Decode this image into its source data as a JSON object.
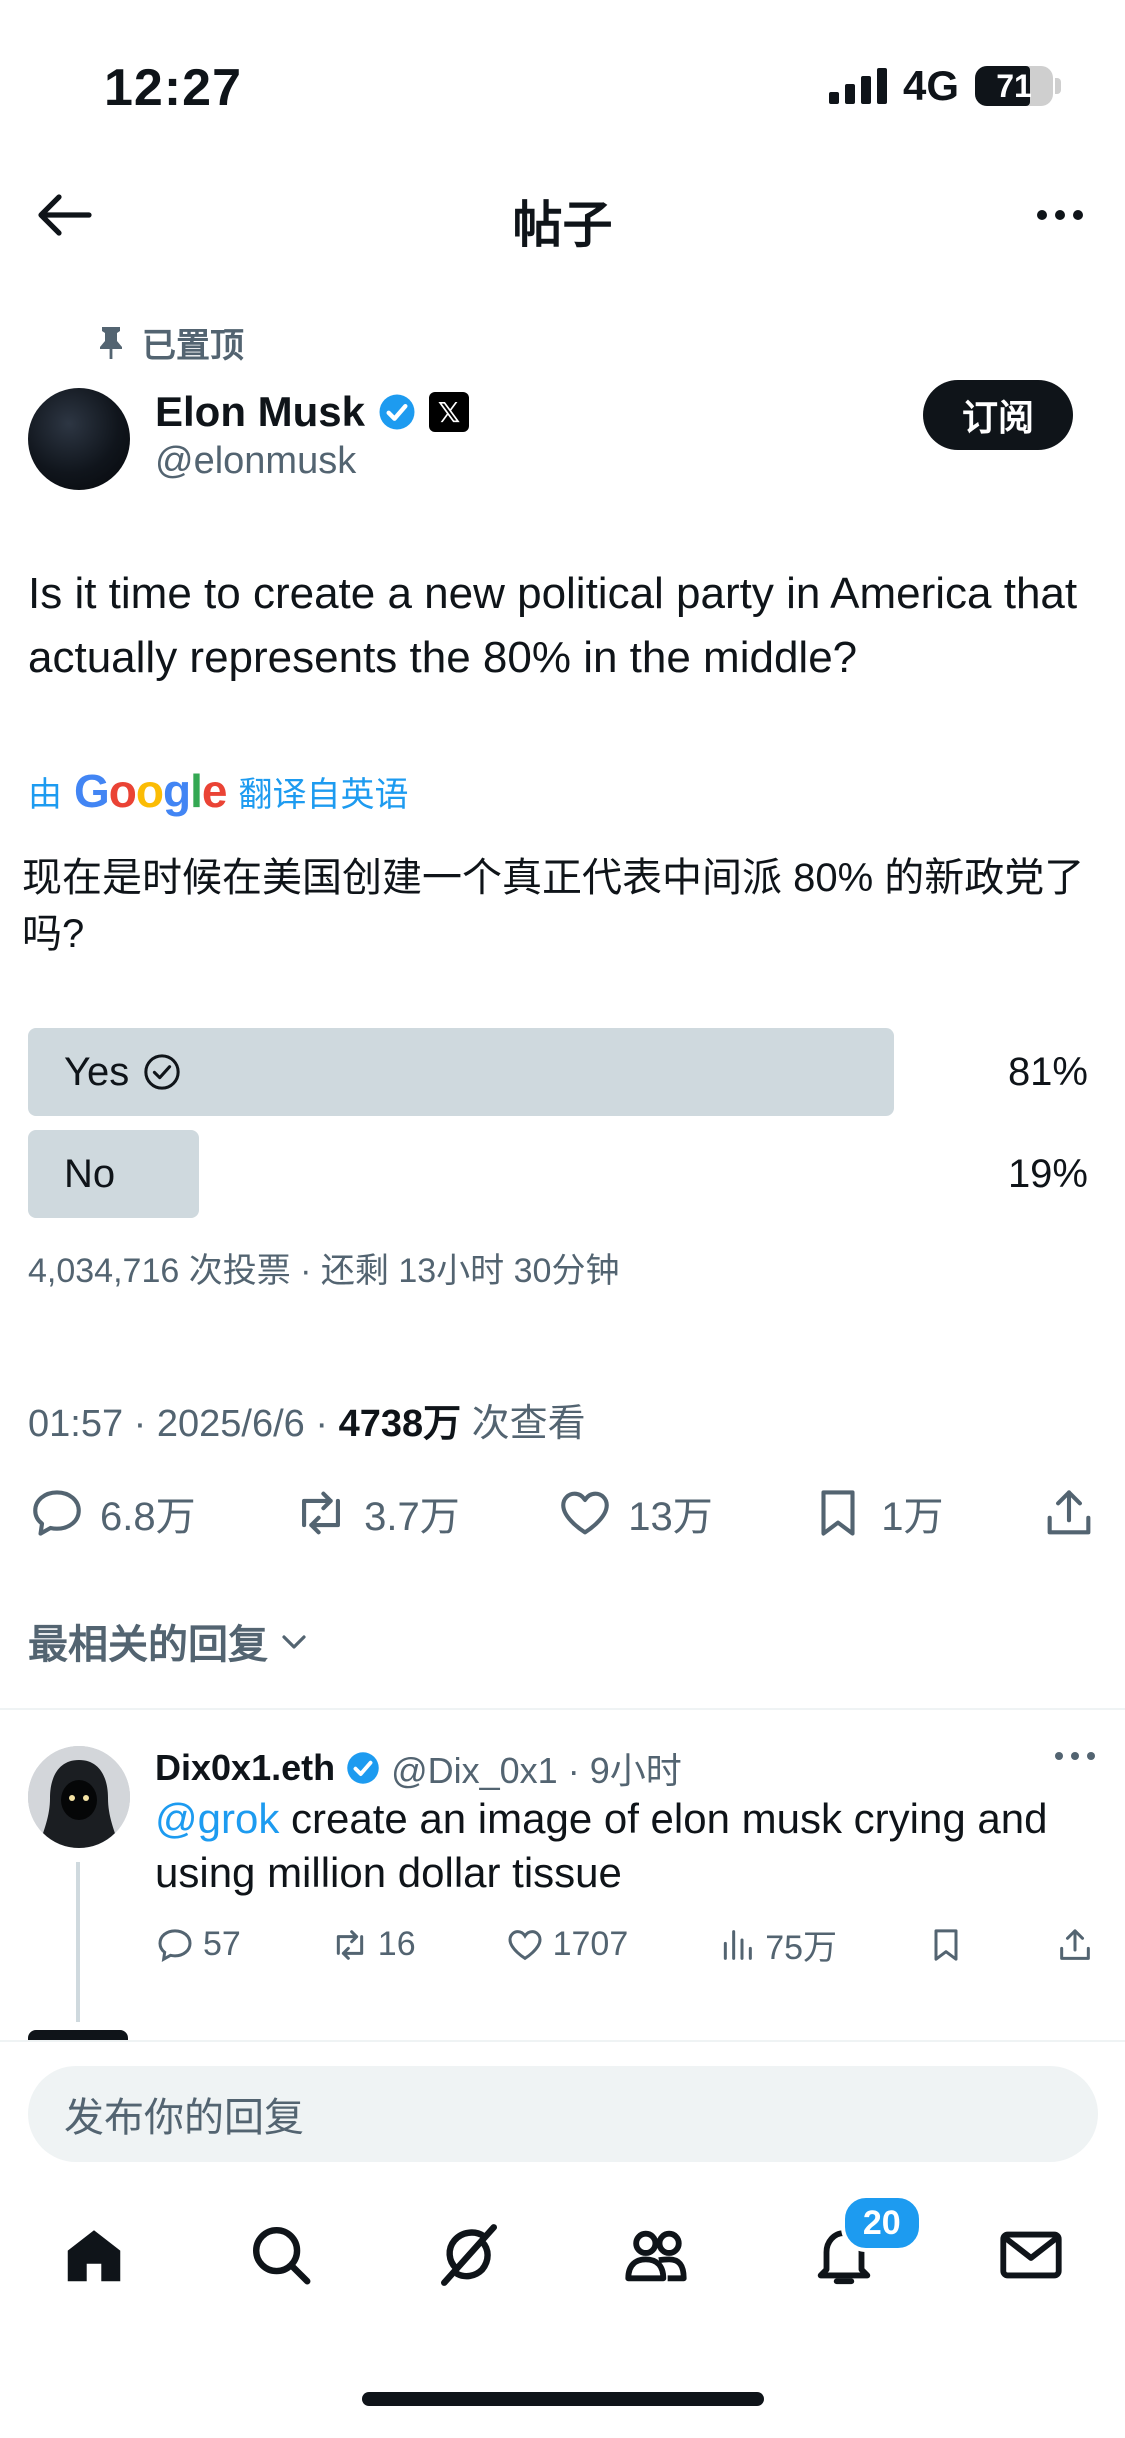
{
  "status_bar": {
    "time": "12:27",
    "network": "4G",
    "battery": "71"
  },
  "header": {
    "title": "帖子"
  },
  "pinned_label": "已置顶",
  "author": {
    "name": "Elon Musk",
    "handle": "@elonmusk",
    "x_badge": "𝕏"
  },
  "subscribe_label": "订阅",
  "tweet": {
    "text": "Is it time to create a new political party in America that actually represents the 80% in the middle?",
    "translate_prefix": "由",
    "translate_suffix": "翻译自英语",
    "translated": "现在是时候在美国创建一个真正代表中间派 80% 的新政党了吗?"
  },
  "poll": {
    "options": [
      {
        "label": "Yes",
        "percent": "81%",
        "fraction": 0.81
      },
      {
        "label": "No",
        "percent": "19%",
        "fraction": 0.19
      }
    ],
    "meta": "4,034,716 次投票 · 还剩 13小时 30分钟"
  },
  "timestamp": {
    "time": "01:57 · 2025/6/6 · ",
    "views": "4738万",
    "views_suffix": " 次查看"
  },
  "actions": {
    "replies": "6.8万",
    "reposts": "3.7万",
    "likes": "13万",
    "bookmarks": "1万"
  },
  "sort_label": "最相关的回复",
  "reply": {
    "name": "Dix0x1.eth",
    "handle": "@Dix_0x1 · 9小时",
    "mention": "@grok",
    "text": " create an image of elon musk crying and using million dollar tissue",
    "replies": "57",
    "reposts": "16",
    "likes": "1707",
    "views": "75万"
  },
  "compose_placeholder": "发布你的回复",
  "notifications_badge": "20",
  "colors": {
    "accent": "#1d9bf0",
    "poll_bar": "#cfd9de",
    "text": "#0f1419",
    "muted": "#536471"
  }
}
